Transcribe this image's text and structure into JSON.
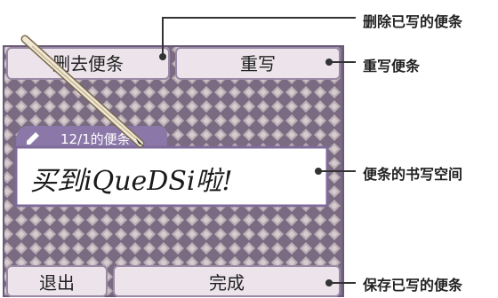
{
  "buttons": {
    "erase": "删去便条",
    "rewrite": "重写",
    "exit": "退出",
    "done": "完成"
  },
  "note": {
    "tab_label": "12/1的便条",
    "handwriting": "买到iQueDSi啦!"
  },
  "annotations": [
    "删除已写的便条",
    "重写便条",
    "便条的书写空间",
    "保存已写的便条"
  ],
  "colors": {
    "pattern_bg": "#7a6a82",
    "button_fill": "#ece4ea",
    "button_border": "#9a8aa6",
    "tab_fill": "#8b78a8",
    "note_border": "#7e6b9a"
  },
  "icons": [
    "pencil-icon",
    "stylus-icon"
  ]
}
